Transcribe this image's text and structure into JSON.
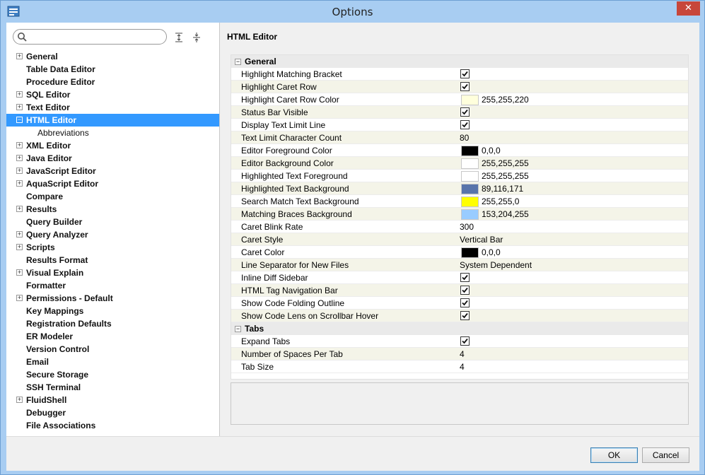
{
  "window": {
    "title": "Options"
  },
  "search": {
    "placeholder": "",
    "value": ""
  },
  "nav": {
    "items": [
      {
        "label": "General",
        "expandable": true,
        "expanded": false
      },
      {
        "label": "Table Data Editor",
        "expandable": false
      },
      {
        "label": "Procedure Editor",
        "expandable": false
      },
      {
        "label": "SQL Editor",
        "expandable": true,
        "expanded": false
      },
      {
        "label": "Text Editor",
        "expandable": true,
        "expanded": false
      },
      {
        "label": "HTML Editor",
        "expandable": true,
        "expanded": true,
        "selected": true
      },
      {
        "label": "Abbreviations",
        "expandable": false,
        "child": true
      },
      {
        "label": "XML Editor",
        "expandable": true,
        "expanded": false
      },
      {
        "label": "Java Editor",
        "expandable": true,
        "expanded": false
      },
      {
        "label": "JavaScript Editor",
        "expandable": true,
        "expanded": false
      },
      {
        "label": "AquaScript Editor",
        "expandable": true,
        "expanded": false
      },
      {
        "label": "Compare",
        "expandable": false
      },
      {
        "label": "Results",
        "expandable": true,
        "expanded": false
      },
      {
        "label": "Query Builder",
        "expandable": false
      },
      {
        "label": "Query Analyzer",
        "expandable": true,
        "expanded": false
      },
      {
        "label": "Scripts",
        "expandable": true,
        "expanded": false
      },
      {
        "label": "Results Format",
        "expandable": false
      },
      {
        "label": "Visual Explain",
        "expandable": true,
        "expanded": false
      },
      {
        "label": "Formatter",
        "expandable": false
      },
      {
        "label": "Permissions - Default",
        "expandable": true,
        "expanded": false
      },
      {
        "label": "Key Mappings",
        "expandable": false
      },
      {
        "label": "Registration Defaults",
        "expandable": false
      },
      {
        "label": "ER Modeler",
        "expandable": false
      },
      {
        "label": "Version Control",
        "expandable": false
      },
      {
        "label": "Email",
        "expandable": false
      },
      {
        "label": "Secure Storage",
        "expandable": false
      },
      {
        "label": "SSH Terminal",
        "expandable": false
      },
      {
        "label": "FluidShell",
        "expandable": true,
        "expanded": false
      },
      {
        "label": "Debugger",
        "expandable": false
      },
      {
        "label": "File Associations",
        "expandable": false
      }
    ]
  },
  "panel": {
    "title": "HTML Editor",
    "groups": [
      {
        "label": "General",
        "rows": [
          {
            "name": "Highlight Matching Bracket",
            "type": "checkbox",
            "checked": true
          },
          {
            "name": "Highlight Caret Row",
            "type": "checkbox",
            "checked": true
          },
          {
            "name": "Highlight Caret Row Color",
            "type": "color",
            "color": "#ffffdc",
            "value": "255,255,220"
          },
          {
            "name": "Status Bar Visible",
            "type": "checkbox",
            "checked": true
          },
          {
            "name": "Display Text Limit Line",
            "type": "checkbox",
            "checked": true
          },
          {
            "name": "Text Limit Character Count",
            "type": "text",
            "value": "80"
          },
          {
            "name": "Editor Foreground Color",
            "type": "color",
            "color": "#000000",
            "value": "0,0,0"
          },
          {
            "name": "Editor Background Color",
            "type": "color",
            "color": "#ffffff",
            "value": "255,255,255"
          },
          {
            "name": "Highlighted Text Foreground",
            "type": "color",
            "color": "#ffffff",
            "value": "255,255,255"
          },
          {
            "name": "Highlighted Text Background",
            "type": "color",
            "color": "#5974ab",
            "value": "89,116,171"
          },
          {
            "name": "Search Match Text Background",
            "type": "color",
            "color": "#ffff00",
            "value": "255,255,0"
          },
          {
            "name": "Matching Braces Background",
            "type": "color",
            "color": "#99ccff",
            "value": "153,204,255"
          },
          {
            "name": "Caret Blink Rate",
            "type": "text",
            "value": "300"
          },
          {
            "name": "Caret Style",
            "type": "text",
            "value": "Vertical Bar"
          },
          {
            "name": "Caret Color",
            "type": "color",
            "color": "#000000",
            "value": "0,0,0"
          },
          {
            "name": "Line Separator for New Files",
            "type": "text",
            "value": "System Dependent"
          },
          {
            "name": "Inline Diff Sidebar",
            "type": "checkbox",
            "checked": true
          },
          {
            "name": "HTML Tag Navigation Bar",
            "type": "checkbox",
            "checked": true
          },
          {
            "name": "Show Code Folding Outline",
            "type": "checkbox",
            "checked": true
          },
          {
            "name": "Show Code Lens on Scrollbar Hover",
            "type": "checkbox",
            "checked": true
          }
        ]
      },
      {
        "label": "Tabs",
        "rows": [
          {
            "name": "Expand Tabs",
            "type": "checkbox",
            "checked": true
          },
          {
            "name": "Number of Spaces Per Tab",
            "type": "text",
            "value": "4"
          },
          {
            "name": "Tab Size",
            "type": "text",
            "value": "4"
          }
        ]
      }
    ]
  },
  "buttons": {
    "ok": "OK",
    "cancel": "Cancel"
  },
  "icons": {
    "app": "options-app-icon",
    "search": "search-icon",
    "expand_all": "expand-all-icon",
    "collapse_all": "collapse-all-icon",
    "close": "close-icon"
  },
  "colors": {
    "selection": "#3399ff",
    "close": "#c7463a",
    "titlebar": "#a8cdf2"
  }
}
